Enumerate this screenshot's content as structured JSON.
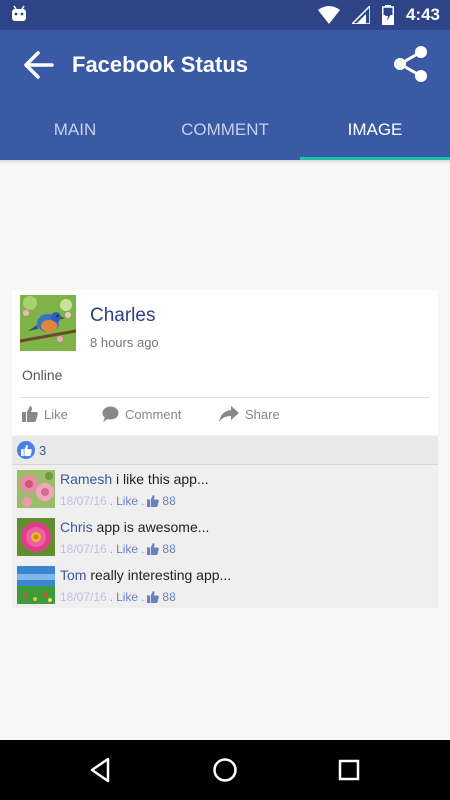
{
  "status_bar": {
    "time": "4:43"
  },
  "app_bar": {
    "title": "Facebook Status"
  },
  "tabs": [
    {
      "label": "MAIN",
      "active": false
    },
    {
      "label": "COMMENT",
      "active": false
    },
    {
      "label": "IMAGE",
      "active": true
    }
  ],
  "post": {
    "name": "Charles",
    "time": "8  hours ago",
    "status": "Online",
    "actions": {
      "like": "Like",
      "comment": "Comment",
      "share": "Share"
    }
  },
  "likes": {
    "count": "3"
  },
  "comments": [
    {
      "author": "Ramesh",
      "text": " i like this app...",
      "date": "18/07/16",
      "sep1": " . ",
      "like": "Like",
      "sep2": " . ",
      "likes": "88"
    },
    {
      "author": "Chris",
      "text": " app is awesome...",
      "date": "18/07/16",
      "sep1": " . ",
      "like": "Like",
      "sep2": " . ",
      "likes": "88"
    },
    {
      "author": "Tom",
      "text": " really interesting app...",
      "date": "18/07/16",
      "sep1": " . ",
      "like": "Like",
      "sep2": " . ",
      "likes": "88"
    }
  ],
  "icons": {
    "back": "arrow-left-icon",
    "share": "share-icon",
    "like": "thumbs-up-icon",
    "comment": "speech-bubble-icon",
    "share_action": "share-arrow-icon"
  },
  "colors": {
    "app_bar": "#3b5aa5",
    "status_bar": "#2e4488",
    "tab_indicator": "#1fbfb0",
    "link": "#3b5998"
  }
}
